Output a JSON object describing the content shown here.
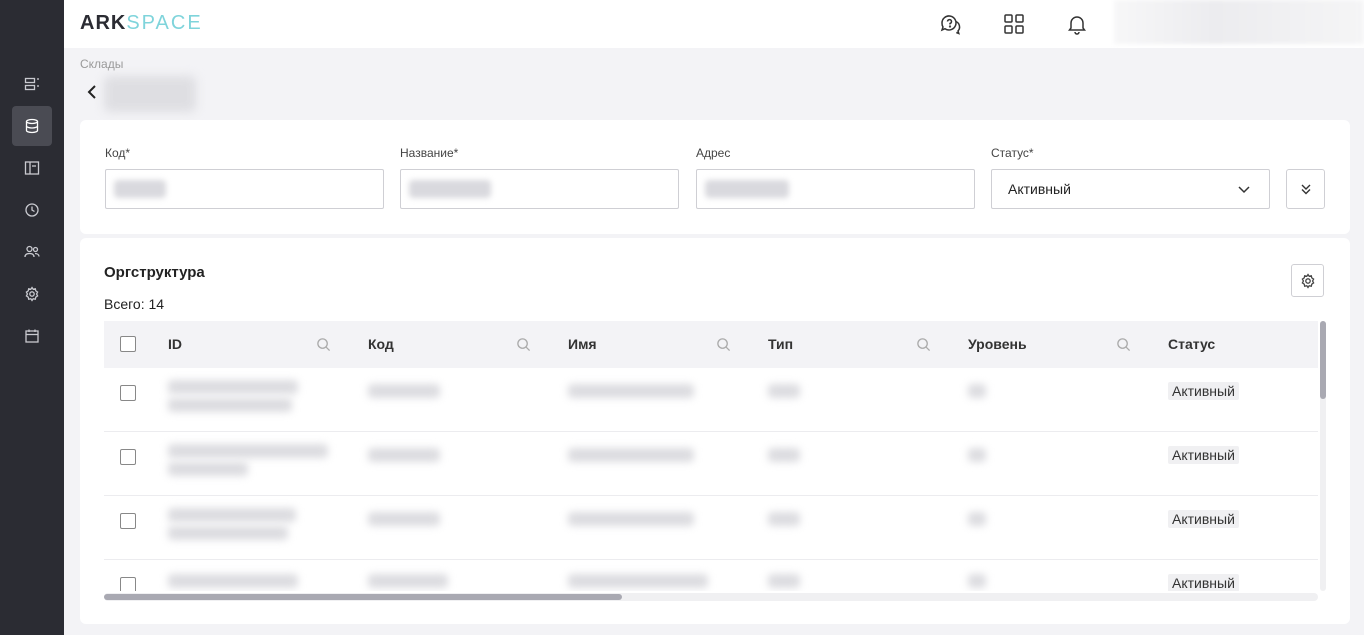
{
  "header": {
    "logo_part1": "ARK",
    "logo_part2": "SPACE",
    "brand_colors": {
      "dark": "#2b2c33",
      "accent": "#7fd4db"
    },
    "icons": [
      "support-chat-icon",
      "apps-grid-icon",
      "notification-bell-icon"
    ]
  },
  "sidebar": {
    "items": [
      {
        "icon": "list-icon",
        "active": false
      },
      {
        "icon": "database-icon",
        "active": true
      },
      {
        "icon": "layout-icon",
        "active": false
      },
      {
        "icon": "clock-icon",
        "active": false
      },
      {
        "icon": "users-icon",
        "active": false
      },
      {
        "icon": "gear-icon",
        "active": false
      },
      {
        "icon": "calendar-icon",
        "active": false
      }
    ]
  },
  "breadcrumb": {
    "parent": "Склады"
  },
  "form": {
    "code_label": "Код*",
    "name_label": "Название*",
    "address_label": "Адрес",
    "status_label": "Статус*",
    "status_value": "Активный"
  },
  "org": {
    "title": "Оргструктура",
    "total": "Всего: 14",
    "columns": [
      "ID",
      "Код",
      "Имя",
      "Тип",
      "Уровень",
      "Статус"
    ],
    "rows": [
      {
        "status": "Активный"
      },
      {
        "status": "Активный"
      },
      {
        "status": "Активный"
      },
      {
        "status": "Активный"
      }
    ]
  }
}
